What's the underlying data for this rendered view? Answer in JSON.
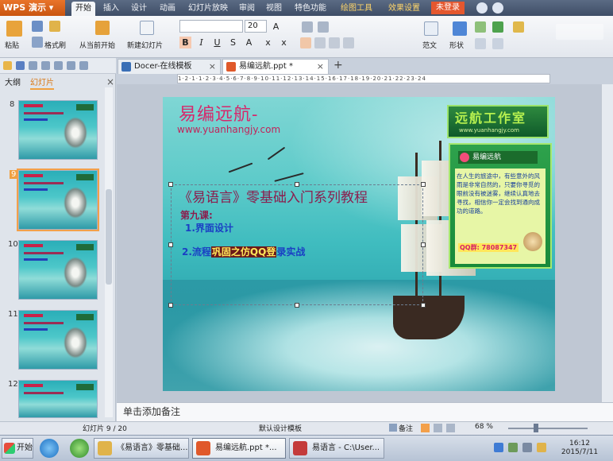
{
  "app": {
    "name": "WPS 演示",
    "login_label": "未登录"
  },
  "menu": {
    "tabs": [
      "开始",
      "插入",
      "设计",
      "动画",
      "幻灯片放映",
      "审阅",
      "视图",
      "特色功能",
      "绘图工具",
      "效果设置"
    ]
  },
  "ribbon": {
    "paste": "粘贴",
    "format_painter": "格式刷",
    "from_current": "从当前开始",
    "new_slide": "新建幻灯片",
    "font_size": "20",
    "font_name": "",
    "template": "范文",
    "shape": "形状"
  },
  "doc_tabs": [
    {
      "label": "Docer-在线模板",
      "close": "×"
    },
    {
      "label": "易编远航.ppt *",
      "close": "×"
    }
  ],
  "add_tab": "+",
  "left_pane": {
    "tabs": [
      "大纲",
      "幻灯片"
    ],
    "close": "×",
    "thumbs": [
      "8",
      "9",
      "10",
      "11",
      "12"
    ]
  },
  "ruler_text": "1·2·1·1·2·3·4·5·6·7·8·9·10·11·12·13·14·15·16·17·18·19·20·21·22·23·24",
  "slide": {
    "title": "易编远航-",
    "url": "www.yuanhangjy.com",
    "course_title": "《易语言》零基础入门系列教程",
    "lesson": "第九课:",
    "item1": "1.界面设计",
    "item2_pre": "2.流程",
    "item2_hl": "巩固之仿QQ登",
    "item2_post": "录实战",
    "studio_name": "远航工作室",
    "studio_url": "www.yuanhangjy.com",
    "card_head": "易编远航",
    "card_text": "在人生的旅途中，有些意外的风雨是非常自然的，只要你寻觅的眼前没有被迷雾，继续认真地去寻找，相信你一定会找到通向成功的道路。",
    "card_qq": "QQ群: 78087347"
  },
  "notes_placeholder": "单击添加备注",
  "status": {
    "slide_counter": "幻灯片 9 / 20",
    "template": "默认设计模板",
    "notes_btn": "备注",
    "zoom": "68 %"
  },
  "taskbar": {
    "start": "开始",
    "items": [
      "《易语言》零基础...",
      "易编远航.ppt *...",
      "易语言 - C:\\User..."
    ],
    "time": "16:12",
    "date": "2015/7/11"
  }
}
